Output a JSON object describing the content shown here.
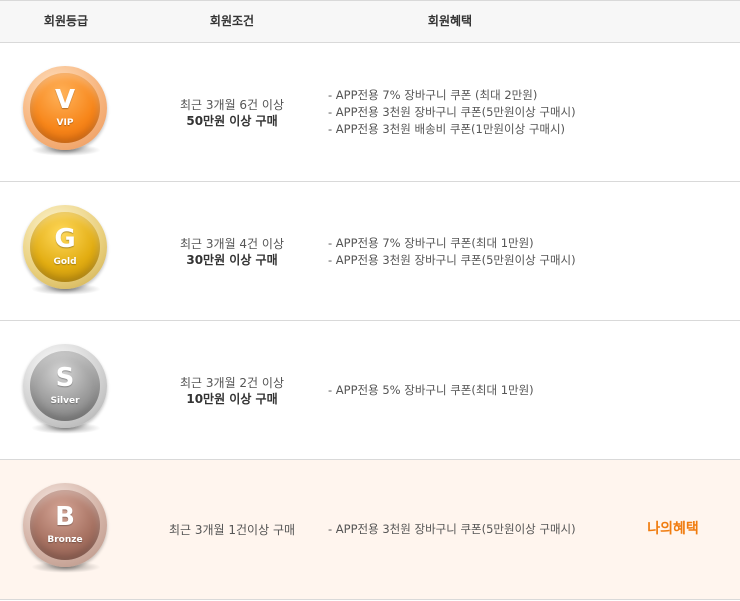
{
  "header": {
    "grade": "회원등급",
    "condition": "회원조건",
    "benefit": "회원혜택"
  },
  "tiers": [
    {
      "letter": "V",
      "name": "VIP",
      "condition_line1": "최근 3개월 6건 이상",
      "condition_line2": "50만원 이상 구매",
      "benefits": [
        "- APP전용 7% 장바구니 쿠폰 (최대 2만원)",
        "- APP전용 3천원 장바구니 쿠폰(5만원이상 구매시)",
        "- APP전용 3천원 배송비 쿠폰(1만원이상 구매시)"
      ],
      "badge_color": "#f7861a"
    },
    {
      "letter": "G",
      "name": "Gold",
      "condition_line1": "최근 3개월 4건 이상",
      "condition_line2": "30만원 이상 구매",
      "benefits": [
        "- APP전용 7% 장바구니 쿠폰(최대 1만원)",
        "- APP전용 3천원 장바구니 쿠폰(5만원이상 구매시)"
      ],
      "badge_color": "#e2ad12"
    },
    {
      "letter": "S",
      "name": "Silver",
      "condition_line1": "최근 3개월 2건 이상",
      "condition_line2": "10만원 이상 구매",
      "benefits": [
        "- APP전용 5% 장바구니 쿠폰(최대 1만원)"
      ],
      "badge_color": "#9a9a9a"
    },
    {
      "letter": "B",
      "name": "Bronze",
      "condition_line1": "최근 3개월 1건이상 구매",
      "condition_line2": "",
      "benefits": [
        "- APP전용 3천원 장바구니 쿠폰(5만원이상 구매시)"
      ],
      "badge_color": "#a77262",
      "current_label": "나의혜택"
    }
  ],
  "colors": {
    "current_row_bg": "#fff5ee",
    "current_label": "#f07c0f",
    "border": "#d9d9d9",
    "header_bg": "#f7f7f7"
  }
}
